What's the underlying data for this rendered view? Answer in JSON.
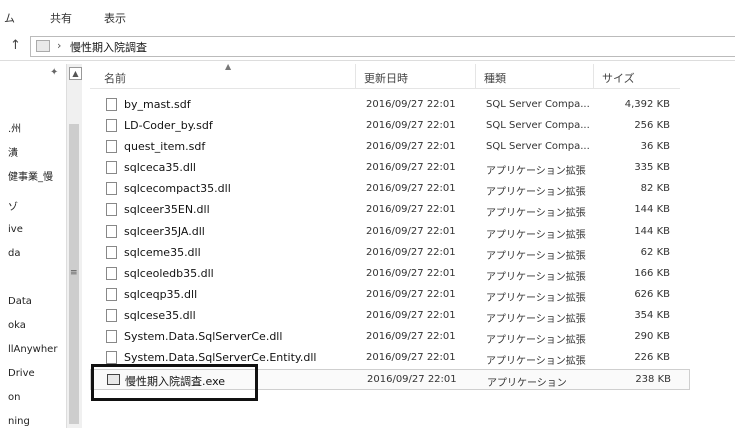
{
  "ribbon": {
    "tabs": [
      "ム",
      "共有",
      "表示"
    ]
  },
  "address": {
    "crumb": "慢性期入院調査"
  },
  "nav": {
    "items": [
      ".州",
      "潰",
      "健事業_慢",
      "ゾ",
      "ive",
      "da",
      "Data",
      "oka",
      "llAnywher",
      "Drive",
      "on",
      "ning"
    ]
  },
  "header": {
    "name": "名前",
    "date": "更新日時",
    "type": "種類",
    "size": "サイズ"
  },
  "files": [
    {
      "name": "by_mast.sdf",
      "date": "2016/09/27 22:01",
      "type": "SQL Server Compa...",
      "size": "4,392 KB"
    },
    {
      "name": "LD-Coder_by.sdf",
      "date": "2016/09/27 22:01",
      "type": "SQL Server Compa...",
      "size": "256 KB"
    },
    {
      "name": "quest_item.sdf",
      "date": "2016/09/27 22:01",
      "type": "SQL Server Compa...",
      "size": "36 KB"
    },
    {
      "name": "sqlceca35.dll",
      "date": "2016/09/27 22:01",
      "type": "アプリケーション拡張",
      "size": "335 KB"
    },
    {
      "name": "sqlcecompact35.dll",
      "date": "2016/09/27 22:01",
      "type": "アプリケーション拡張",
      "size": "82 KB"
    },
    {
      "name": "sqlceer35EN.dll",
      "date": "2016/09/27 22:01",
      "type": "アプリケーション拡張",
      "size": "144 KB"
    },
    {
      "name": "sqlceer35JA.dll",
      "date": "2016/09/27 22:01",
      "type": "アプリケーション拡張",
      "size": "144 KB"
    },
    {
      "name": "sqlceme35.dll",
      "date": "2016/09/27 22:01",
      "type": "アプリケーション拡張",
      "size": "62 KB"
    },
    {
      "name": "sqlceoledb35.dll",
      "date": "2016/09/27 22:01",
      "type": "アプリケーション拡張",
      "size": "166 KB"
    },
    {
      "name": "sqlceqp35.dll",
      "date": "2016/09/27 22:01",
      "type": "アプリケーション拡張",
      "size": "626 KB"
    },
    {
      "name": "sqlcese35.dll",
      "date": "2016/09/27 22:01",
      "type": "アプリケーション拡張",
      "size": "354 KB"
    },
    {
      "name": "System.Data.SqlServerCe.dll",
      "date": "2016/09/27 22:01",
      "type": "アプリケーション拡張",
      "size": "290 KB"
    },
    {
      "name": "System.Data.SqlServerCe.Entity.dll",
      "date": "2016/09/27 22:01",
      "type": "アプリケーション拡張",
      "size": "226 KB"
    },
    {
      "name": "慢性期入院調査.exe",
      "date": "2016/09/27 22:01",
      "type": "アプリケーション",
      "size": "238 KB"
    }
  ],
  "icons": {
    "up": "up-arrow-icon",
    "folder": "folder-icon",
    "pin": "pin-icon"
  }
}
